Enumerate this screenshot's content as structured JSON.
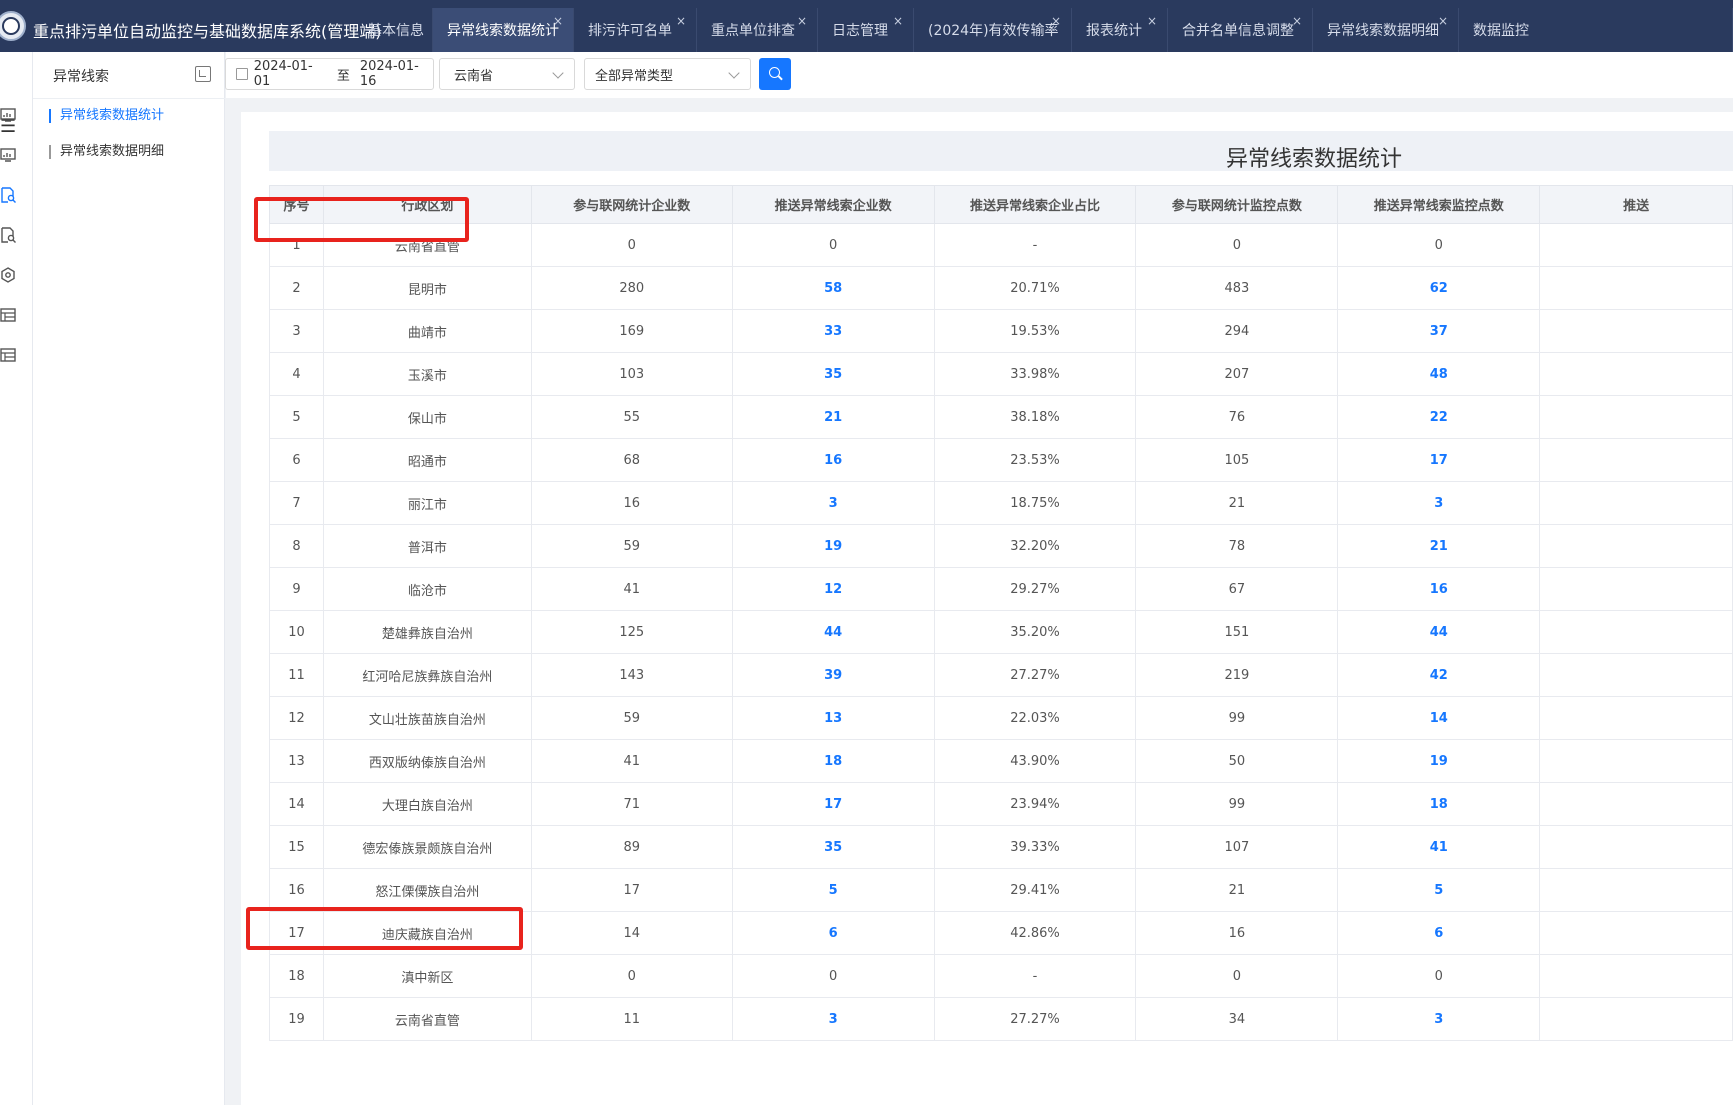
{
  "app": {
    "title": "重点排污单位自动监控与基础数据库系统(管理端)",
    "tabs": [
      {
        "label": "基本信息",
        "closable": false,
        "active": false
      },
      {
        "label": "异常线索数据统计",
        "closable": true,
        "active": true
      },
      {
        "label": "排污许可名单",
        "closable": true,
        "active": false
      },
      {
        "label": "重点单位排查",
        "closable": true,
        "active": false
      },
      {
        "label": "日志管理",
        "closable": true,
        "active": false
      },
      {
        "label": "(2024年)有效传输率",
        "closable": true,
        "active": false
      },
      {
        "label": "报表统计",
        "closable": true,
        "active": false
      },
      {
        "label": "合并名单信息调整",
        "closable": true,
        "active": false
      },
      {
        "label": "异常线索数据明细",
        "closable": true,
        "active": false
      },
      {
        "label": "数据监控",
        "closable": false,
        "active": false
      }
    ],
    "close_glyph": "×"
  },
  "rail": {
    "menu_glyph": "☰",
    "icons": [
      "monitor-chart-icon",
      "monitor-chart-icon",
      "document-search-icon",
      "document-search-icon",
      "settings-shield-icon",
      "table-doc-icon",
      "table-doc-icon"
    ]
  },
  "subnav": {
    "title": "异常线索",
    "items": [
      {
        "label": "异常线索数据统计",
        "active": true
      },
      {
        "label": "异常线索数据明细",
        "active": false
      }
    ]
  },
  "filters": {
    "date_start": "2024-01-01",
    "date_sep": "至",
    "date_end": "2024-01-16",
    "region": "云南省",
    "anomaly_type": "全部异常类型"
  },
  "report": {
    "title": "异常线索数据统计",
    "columns": [
      "序号",
      "行政区划",
      "参与联网统计企业数",
      "推送异常线索企业数",
      "推送异常线索企业占比",
      "参与联网统计监控点数",
      "推送异常线索监控点数",
      "推送"
    ],
    "rows": [
      [
        "1",
        "云南省直管",
        "0",
        "0",
        "-",
        "0",
        "0"
      ],
      [
        "2",
        "昆明市",
        "280",
        "58",
        "20.71%",
        "483",
        "62"
      ],
      [
        "3",
        "曲靖市",
        "169",
        "33",
        "19.53%",
        "294",
        "37"
      ],
      [
        "4",
        "玉溪市",
        "103",
        "35",
        "33.98%",
        "207",
        "48"
      ],
      [
        "5",
        "保山市",
        "55",
        "21",
        "38.18%",
        "76",
        "22"
      ],
      [
        "6",
        "昭通市",
        "68",
        "16",
        "23.53%",
        "105",
        "17"
      ],
      [
        "7",
        "丽江市",
        "16",
        "3",
        "18.75%",
        "21",
        "3"
      ],
      [
        "8",
        "普洱市",
        "59",
        "19",
        "32.20%",
        "78",
        "21"
      ],
      [
        "9",
        "临沧市",
        "41",
        "12",
        "29.27%",
        "67",
        "16"
      ],
      [
        "10",
        "楚雄彝族自治州",
        "125",
        "44",
        "35.20%",
        "151",
        "44"
      ],
      [
        "11",
        "红河哈尼族彝族自治州",
        "143",
        "39",
        "27.27%",
        "219",
        "42"
      ],
      [
        "12",
        "文山壮族苗族自治州",
        "59",
        "13",
        "22.03%",
        "99",
        "14"
      ],
      [
        "13",
        "西双版纳傣族自治州",
        "41",
        "18",
        "43.90%",
        "50",
        "19"
      ],
      [
        "14",
        "大理白族自治州",
        "71",
        "17",
        "23.94%",
        "99",
        "18"
      ],
      [
        "15",
        "德宏傣族景颇族自治州",
        "89",
        "35",
        "39.33%",
        "107",
        "41"
      ],
      [
        "16",
        "怒江傈僳族自治州",
        "17",
        "5",
        "29.41%",
        "21",
        "5"
      ],
      [
        "17",
        "迪庆藏族自治州",
        "14",
        "6",
        "42.86%",
        "16",
        "6"
      ],
      [
        "18",
        "滇中新区",
        "0",
        "0",
        "-",
        "0",
        "0"
      ],
      [
        "19",
        "云南省直管",
        "11",
        "3",
        "27.27%",
        "34",
        "3"
      ]
    ]
  },
  "colors": {
    "topbar": "#2a3a5e",
    "accent": "#1677ff",
    "highlight": "#e8231d"
  }
}
